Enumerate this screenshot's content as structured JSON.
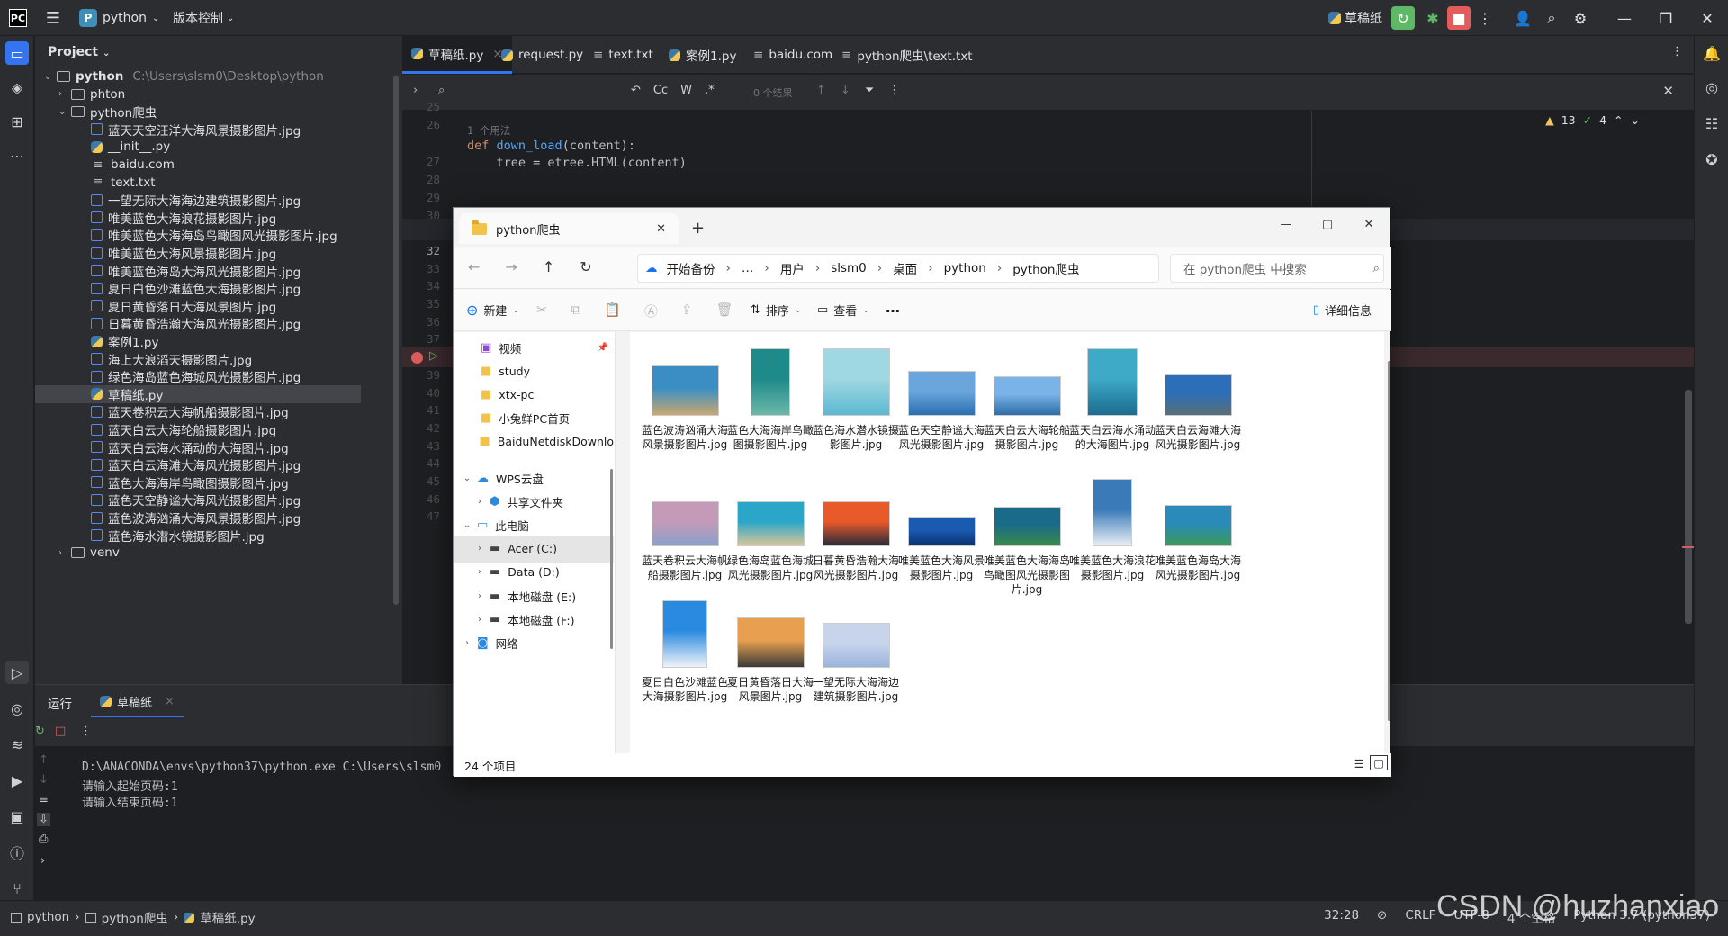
{
  "titlebar": {
    "logo": "PC",
    "project_badge": "P",
    "project_name": "python",
    "vcs_label": "版本控制",
    "run_config": "草稿纸"
  },
  "project_panel": {
    "header": "Project",
    "tree": [
      {
        "label": "python",
        "path": "C:\\Users\\slsm0\\Desktop\\python",
        "type": "folder",
        "depth": 0,
        "expanded": true
      },
      {
        "label": "phton",
        "type": "folder",
        "depth": 1,
        "expanded": false
      },
      {
        "label": "python爬虫",
        "type": "folder",
        "depth": 1,
        "expanded": true
      },
      {
        "label": "蓝天天空汪洋大海风景摄影图片.jpg",
        "type": "img",
        "depth": 2
      },
      {
        "label": "__init__.py",
        "type": "py",
        "depth": 2
      },
      {
        "label": "baidu.com",
        "type": "txt",
        "depth": 2
      },
      {
        "label": "text.txt",
        "type": "txt",
        "depth": 2
      },
      {
        "label": "一望无际大海海边建筑摄影图片.jpg",
        "type": "img",
        "depth": 2
      },
      {
        "label": "唯美蓝色大海浪花摄影图片.jpg",
        "type": "img",
        "depth": 2
      },
      {
        "label": "唯美蓝色大海海岛鸟瞰图风光摄影图片.jpg",
        "type": "img",
        "depth": 2
      },
      {
        "label": "唯美蓝色大海风景摄影图片.jpg",
        "type": "img",
        "depth": 2
      },
      {
        "label": "唯美蓝色海岛大海风光摄影图片.jpg",
        "type": "img",
        "depth": 2
      },
      {
        "label": "夏日白色沙滩蓝色大海摄影图片.jpg",
        "type": "img",
        "depth": 2
      },
      {
        "label": "夏日黄昏落日大海风景图片.jpg",
        "type": "img",
        "depth": 2
      },
      {
        "label": "日暮黄昏浩瀚大海风光摄影图片.jpg",
        "type": "img",
        "depth": 2
      },
      {
        "label": "案例1.py",
        "type": "py",
        "depth": 2
      },
      {
        "label": "海上大浪滔天摄影图片.jpg",
        "type": "img",
        "depth": 2
      },
      {
        "label": "绿色海岛蓝色海城风光摄影图片.jpg",
        "type": "img",
        "depth": 2
      },
      {
        "label": "草稿纸.py",
        "type": "py",
        "depth": 2,
        "selected": true
      },
      {
        "label": "蓝天卷积云大海帆船摄影图片.jpg",
        "type": "img",
        "depth": 2
      },
      {
        "label": "蓝天白云大海轮船摄影图片.jpg",
        "type": "img",
        "depth": 2
      },
      {
        "label": "蓝天白云海水涌动的大海图片.jpg",
        "type": "img",
        "depth": 2
      },
      {
        "label": "蓝天白云海滩大海风光摄影图片.jpg",
        "type": "img",
        "depth": 2
      },
      {
        "label": "蓝色大海海岸鸟瞰图摄影图片.jpg",
        "type": "img",
        "depth": 2
      },
      {
        "label": "蓝色天空静谧大海风光摄影图片.jpg",
        "type": "img",
        "depth": 2
      },
      {
        "label": "蓝色波涛汹涌大海风景摄影图片.jpg",
        "type": "img",
        "depth": 2
      },
      {
        "label": "蓝色海水潜水镜摄影图片.jpg",
        "type": "img",
        "depth": 2
      },
      {
        "label": "venv",
        "type": "folder",
        "depth": 1,
        "expanded": false
      }
    ]
  },
  "editor": {
    "tabs": [
      {
        "label": "草稿纸.py",
        "icon": "python-file-icon",
        "active": true
      },
      {
        "label": "request.py",
        "icon": "python-file-icon"
      },
      {
        "label": "text.txt",
        "icon": "text-file-icon"
      },
      {
        "label": "案例1.py",
        "icon": "python-file-icon"
      },
      {
        "label": "baidu.com",
        "icon": "text-file-icon"
      },
      {
        "label": "python爬虫\\text.txt",
        "icon": "text-file-icon"
      }
    ],
    "search": {
      "results": "0 个结果",
      "match_case": "Cc",
      "words": "W",
      "regex": ".*"
    },
    "inspections": {
      "warnings": "13",
      "ok": "4"
    },
    "line_numbers": [
      "25",
      "26",
      "27",
      "28",
      "29",
      "30",
      "31",
      "32",
      "33",
      "34",
      "35",
      "36",
      "37",
      "38",
      "39",
      "40",
      "41",
      "42",
      "43",
      "44",
      "45",
      "46",
      "47"
    ],
    "code": {
      "usage_hint": "1 个用法",
      "def_kw": "def",
      "fn_name": "down_load",
      "fn_params": "(content):",
      "line28": "    tree = etree.HTML(content)"
    }
  },
  "run_panel": {
    "tab_run": "运行",
    "tab_file": "草稿纸",
    "output": [
      "D:\\ANACONDA\\envs\\python37\\python.exe C:\\Users\\slsm0",
      "请输入起始页码:1",
      "请输入结束页码:1"
    ]
  },
  "statusbar": {
    "crumbs": [
      "python",
      "python爬虫",
      "草稿纸.py"
    ],
    "position": "32:28",
    "line_sep": "CRLF",
    "encoding": "UTF-8",
    "indent": "4 个空格",
    "interpreter": "Python 3.7 (python37)"
  },
  "explorer": {
    "tab_title": "python爬虫",
    "breadcrumbs": [
      "开始备份",
      "…",
      "用户",
      "slsm0",
      "桌面",
      "python",
      "python爬虫"
    ],
    "search_placeholder": "在 python爬虫 中搜索",
    "cmd": {
      "new": "新建",
      "sort": "排序",
      "view": "查看",
      "more": "…",
      "details": "详细信息"
    },
    "nav": [
      {
        "label": "视频",
        "icon": "video-icon",
        "pinned": true
      },
      {
        "label": "study",
        "icon": "folder-icon"
      },
      {
        "label": "xtx-pc",
        "icon": "folder-icon"
      },
      {
        "label": "小兔鲜PC首页",
        "icon": "folder-icon"
      },
      {
        "label": "BaiduNetdiskDownlo",
        "icon": "folder-icon"
      },
      {
        "label": "WPS云盘",
        "icon": "cloud-icon",
        "expandable": true
      },
      {
        "label": "共享文件夹",
        "icon": "share-icon",
        "expandable": true
      },
      {
        "label": "此电脑",
        "icon": "pc-icon",
        "expandable": true
      },
      {
        "label": "Acer (C:)",
        "icon": "drive-icon",
        "expandable": true,
        "selected": true
      },
      {
        "label": "Data (D:)",
        "icon": "drive-icon",
        "expandable": true
      },
      {
        "label": "本地磁盘 (E:)",
        "icon": "drive-icon",
        "expandable": true
      },
      {
        "label": "本地磁盘 (F:)",
        "icon": "drive-icon",
        "expandable": true
      },
      {
        "label": "网络",
        "icon": "network-icon",
        "expandable": true
      }
    ],
    "files": [
      {
        "name": "蓝色波涛汹涌大海风景摄影图片.jpg",
        "colors": [
          "#3a8ec4",
          "#c9a870"
        ]
      },
      {
        "name": "蓝色大海海岸鸟瞰图摄影图片.jpg",
        "colors": [
          "#1f8a8a",
          "#6bb8a8"
        ]
      },
      {
        "name": "蓝色海水潜水镜摄影图片.jpg",
        "colors": [
          "#9fd8e2",
          "#5cb8d0"
        ]
      },
      {
        "name": "蓝色天空静谧大海风光摄影图片.jpg",
        "colors": [
          "#6aa6dc",
          "#2a6fb0"
        ]
      },
      {
        "name": "蓝天白云大海轮船摄影图片.jpg",
        "colors": [
          "#7ab3e8",
          "#2d6da8"
        ]
      },
      {
        "name": "蓝天白云海水涌动的大海图片.jpg",
        "colors": [
          "#3fa9c8",
          "#1b6c8e"
        ]
      },
      {
        "name": "蓝天白云海滩大海风光摄影图片.jpg",
        "colors": [
          "#2c6fb8",
          "#5a6f78"
        ]
      },
      {
        "name": "蓝天卷积云大海帆船摄影图片.jpg",
        "colors": [
          "#c49ab8",
          "#8aa0c8"
        ]
      },
      {
        "name": "绿色海岛蓝色海城风光摄影图片.jpg",
        "colors": [
          "#2aa6c8",
          "#d8c69a"
        ]
      },
      {
        "name": "日暮黄昏浩瀚大海风光摄影图片.jpg",
        "colors": [
          "#e85a2a",
          "#2a2a3a"
        ]
      },
      {
        "name": "唯美蓝色大海风景摄影图片.jpg",
        "colors": [
          "#1a5ab0",
          "#0a3070"
        ]
      },
      {
        "name": "唯美蓝色大海海岛鸟瞰图风光摄影图片.jpg",
        "colors": [
          "#1a6a8a",
          "#3a8a4a"
        ]
      },
      {
        "name": "唯美蓝色大海浪花摄影图片.jpg",
        "colors": [
          "#3a7ab8",
          "#e8eef4"
        ]
      },
      {
        "name": "唯美蓝色海岛大海风光摄影图片.jpg",
        "colors": [
          "#2a8ab8",
          "#3a9a5a"
        ]
      },
      {
        "name": "夏日白色沙滩蓝色大海摄影图片.jpg",
        "colors": [
          "#2a8ae0",
          "#f0f4f8"
        ]
      },
      {
        "name": "夏日黄昏落日大海风景图片.jpg",
        "colors": [
          "#e8a050",
          "#3a3a3a"
        ]
      },
      {
        "name": "一望无际大海海边建筑摄影图片.jpg",
        "colors": [
          "#c8d4ec",
          "#9ab4dc"
        ]
      }
    ],
    "item_count": "24 个项目"
  }
}
